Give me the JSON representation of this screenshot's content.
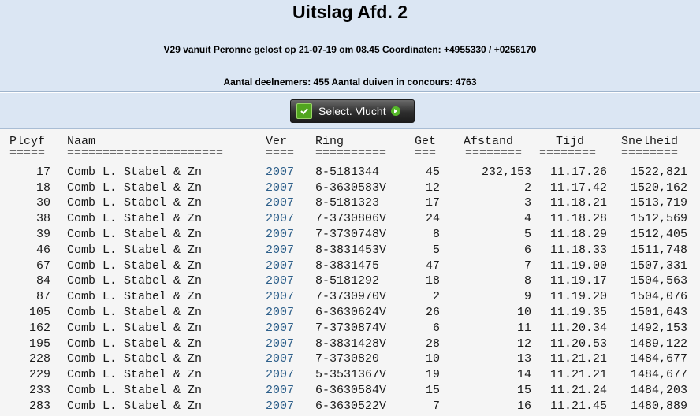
{
  "header": {
    "title": "Uitslag Afd. 2",
    "flight_info": "V29 vanuit Peronne gelost op 21-07-19 om 08.45 Coordinaten: +4955330 / +0256170",
    "participants": "Aantal deelnemers: 455 Aantal duiven in concours: 4763",
    "select_button_label": "Select. Vlucht",
    "select_icon": "green-select-icon",
    "arrow_icon": "green-arrow-icon"
  },
  "table": {
    "columns": [
      "Plcyf",
      "Naam",
      "Ver",
      "Ring",
      "Get",
      "Afstand",
      "Tijd",
      "Snelheid"
    ],
    "separators": [
      "=====",
      "======================",
      "====",
      "==========",
      "===",
      "========",
      "========",
      "========"
    ],
    "rows": [
      {
        "plcyf": "17",
        "naam": "Comb L. Stabel & Zn",
        "ver": "2007",
        "ring": "8-5181344",
        "get": "45",
        "afstand": "232,153",
        "tijd": "11.17.26",
        "snelheid": "1522,821"
      },
      {
        "plcyf": "18",
        "naam": "Comb L. Stabel & Zn",
        "ver": "2007",
        "ring": "6-3630583V",
        "get": "12",
        "afstand": "2",
        "tijd": "11.17.42",
        "snelheid": "1520,162"
      },
      {
        "plcyf": "30",
        "naam": "Comb L. Stabel & Zn",
        "ver": "2007",
        "ring": "8-5181323",
        "get": "17",
        "afstand": "3",
        "tijd": "11.18.21",
        "snelheid": "1513,719"
      },
      {
        "plcyf": "38",
        "naam": "Comb L. Stabel & Zn",
        "ver": "2007",
        "ring": "7-3730806V",
        "get": "24",
        "afstand": "4",
        "tijd": "11.18.28",
        "snelheid": "1512,569"
      },
      {
        "plcyf": "39",
        "naam": "Comb L. Stabel & Zn",
        "ver": "2007",
        "ring": "7-3730748V",
        "get": "8",
        "afstand": "5",
        "tijd": "11.18.29",
        "snelheid": "1512,405"
      },
      {
        "plcyf": "46",
        "naam": "Comb L. Stabel & Zn",
        "ver": "2007",
        "ring": "8-3831453V",
        "get": "5",
        "afstand": "6",
        "tijd": "11.18.33",
        "snelheid": "1511,748"
      },
      {
        "plcyf": "67",
        "naam": "Comb L. Stabel & Zn",
        "ver": "2007",
        "ring": "8-3831475",
        "get": "47",
        "afstand": "7",
        "tijd": "11.19.00",
        "snelheid": "1507,331"
      },
      {
        "plcyf": "84",
        "naam": "Comb L. Stabel & Zn",
        "ver": "2007",
        "ring": "8-5181292",
        "get": "18",
        "afstand": "8",
        "tijd": "11.19.17",
        "snelheid": "1504,563"
      },
      {
        "plcyf": "87",
        "naam": "Comb L. Stabel & Zn",
        "ver": "2007",
        "ring": "7-3730970V",
        "get": "2",
        "afstand": "9",
        "tijd": "11.19.20",
        "snelheid": "1504,076"
      },
      {
        "plcyf": "105",
        "naam": "Comb L. Stabel & Zn",
        "ver": "2007",
        "ring": "6-3630624V",
        "get": "26",
        "afstand": "10",
        "tijd": "11.19.35",
        "snelheid": "1501,643"
      },
      {
        "plcyf": "162",
        "naam": "Comb L. Stabel & Zn",
        "ver": "2007",
        "ring": "7-3730874V",
        "get": "6",
        "afstand": "11",
        "tijd": "11.20.34",
        "snelheid": "1492,153"
      },
      {
        "plcyf": "195",
        "naam": "Comb L. Stabel & Zn",
        "ver": "2007",
        "ring": "8-3831428V",
        "get": "28",
        "afstand": "12",
        "tijd": "11.20.53",
        "snelheid": "1489,122"
      },
      {
        "plcyf": "228",
        "naam": "Comb L. Stabel & Zn",
        "ver": "2007",
        "ring": "7-3730820",
        "get": "10",
        "afstand": "13",
        "tijd": "11.21.21",
        "snelheid": "1484,677"
      },
      {
        "plcyf": "229",
        "naam": "Comb L. Stabel & Zn",
        "ver": "2007",
        "ring": "5-3531367V",
        "get": "19",
        "afstand": "14",
        "tijd": "11.21.21",
        "snelheid": "1484,677"
      },
      {
        "plcyf": "233",
        "naam": "Comb L. Stabel & Zn",
        "ver": "2007",
        "ring": "6-3630584V",
        "get": "15",
        "afstand": "15",
        "tijd": "11.21.24",
        "snelheid": "1484,203"
      },
      {
        "plcyf": "283",
        "naam": "Comb L. Stabel & Zn",
        "ver": "2007",
        "ring": "6-3630522V",
        "get": "7",
        "afstand": "16",
        "tijd": "11.21.45",
        "snelheid": "1480,889"
      }
    ]
  },
  "colors": {
    "header_bg": "#dbe6f3",
    "body_bg": "#f5f5f5",
    "link": "#2d5f8a",
    "button_bg": "#2e2e2e",
    "icon_green": "#51a520"
  }
}
